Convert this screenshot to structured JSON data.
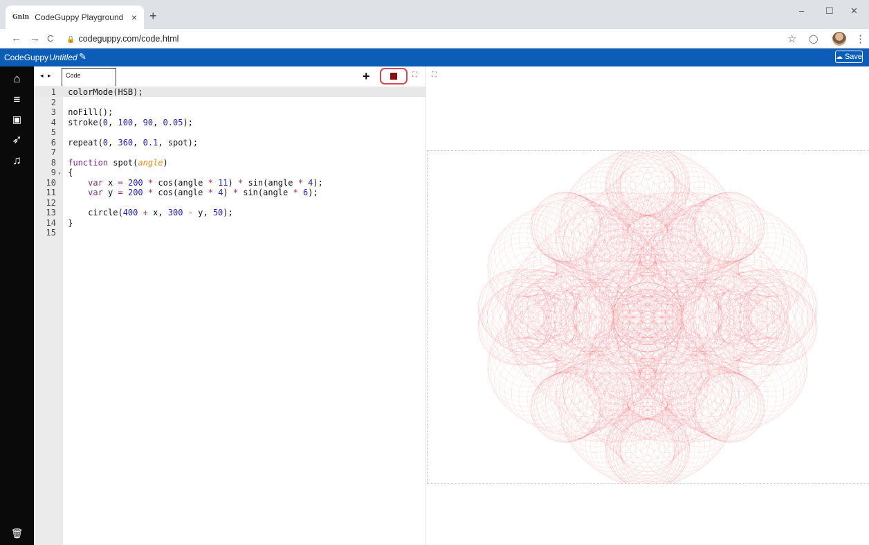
{
  "browser": {
    "tab_title": "CodeGuppy Playground",
    "favicon_text": "Gnln",
    "tab_close": "×",
    "new_tab": "+",
    "url": "codeguppy.com/code.html",
    "window_controls": {
      "minimize": "–",
      "maximize": "☐",
      "close": "✕"
    },
    "nav": {
      "back": "←",
      "forward": "→",
      "reload": "C"
    },
    "icons": {
      "star": "☆",
      "extension": "◯",
      "menu": "⋮"
    }
  },
  "app": {
    "brand": "CodeGuppy",
    "project_name": "Untitled",
    "save_label": "Save",
    "accent_color": "#0b5db8"
  },
  "editor": {
    "tab_label": "Code",
    "arrows": "◂ ▸",
    "add_label": "+",
    "lines": [
      {
        "n": "1",
        "fold": "",
        "code": "colorMode(HSB);"
      },
      {
        "n": "2",
        "fold": "",
        "code": ""
      },
      {
        "n": "3",
        "fold": "",
        "code": "noFill();"
      },
      {
        "n": "4",
        "fold": "",
        "code": "stroke(0, 100, 90, 0.05);"
      },
      {
        "n": "5",
        "fold": "",
        "code": ""
      },
      {
        "n": "6",
        "fold": "",
        "code": "repeat(0, 360, 0.1, spot);"
      },
      {
        "n": "7",
        "fold": "",
        "code": ""
      },
      {
        "n": "8",
        "fold": "",
        "code": "function spot(angle)"
      },
      {
        "n": "9",
        "fold": "▾",
        "code": "{"
      },
      {
        "n": "10",
        "fold": "",
        "code": "    var x = 200 * cos(angle * 11) * sin(angle * 4);"
      },
      {
        "n": "11",
        "fold": "",
        "code": "    var y = 200 * cos(angle * 4) * sin(angle * 6);"
      },
      {
        "n": "12",
        "fold": "",
        "code": ""
      },
      {
        "n": "13",
        "fold": "",
        "code": "    circle(400 + x, 300 - y, 50);"
      },
      {
        "n": "14",
        "fold": "",
        "code": "}"
      },
      {
        "n": "15",
        "fold": "",
        "code": ""
      }
    ]
  },
  "sidebar": {
    "items": [
      {
        "name": "home-icon",
        "glyph": "⌂"
      },
      {
        "name": "menu-icon",
        "glyph": "≡"
      },
      {
        "name": "image-icon",
        "glyph": "▣"
      },
      {
        "name": "rocket-icon",
        "glyph": "➶"
      },
      {
        "name": "music-icon",
        "glyph": "♫"
      }
    ],
    "trash_glyph": "🗑"
  },
  "canvas": {
    "stroke_color": "#e8323c"
  }
}
